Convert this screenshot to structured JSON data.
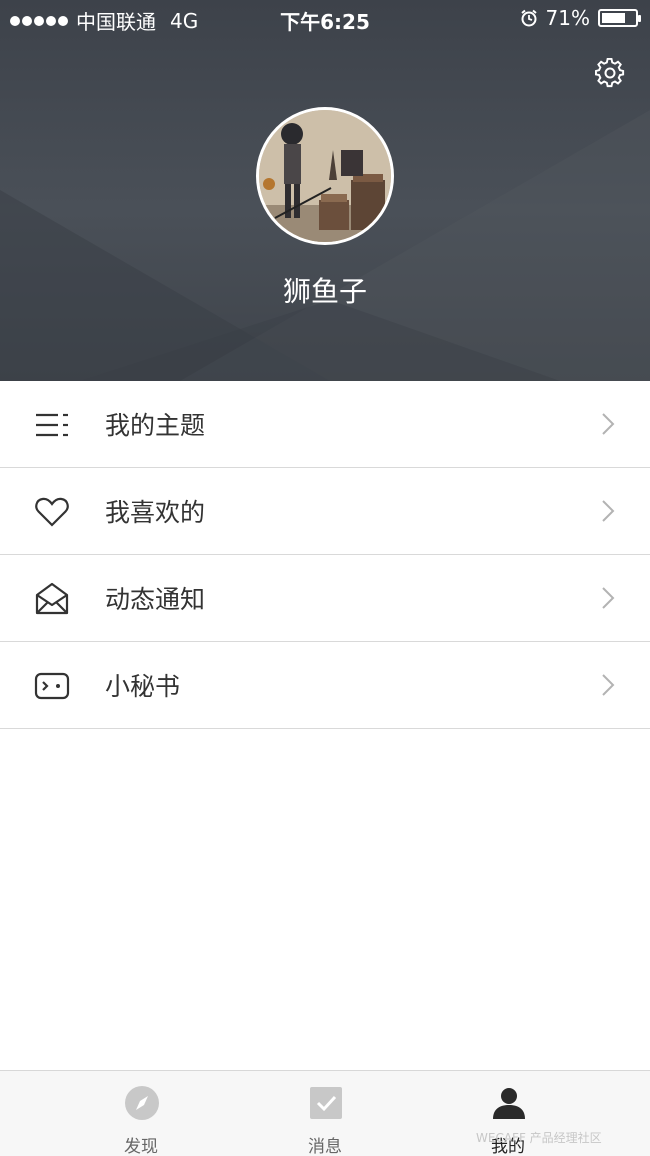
{
  "status_bar": {
    "carrier": "中国联通",
    "network": "4G",
    "time": "下午6:25",
    "battery_percent": "71%",
    "battery_level": 0.71
  },
  "profile": {
    "username": "狮鱼子",
    "settings_icon": "gear-icon",
    "avatar": "user-avatar"
  },
  "menu": [
    {
      "label": "我的主题",
      "icon": "list-icon"
    },
    {
      "label": "我喜欢的",
      "icon": "heart-icon"
    },
    {
      "label": "动态通知",
      "icon": "envelope-open-icon"
    },
    {
      "label": "小秘书",
      "icon": "assistant-icon"
    }
  ],
  "tabs": [
    {
      "label": "发现",
      "icon": "compass-icon",
      "active": false
    },
    {
      "label": "消息",
      "icon": "checkbox-icon",
      "active": false
    },
    {
      "label": "我的",
      "icon": "user-icon",
      "active": true
    }
  ],
  "watermark": "WECAFF 产品经理社区",
  "colors": {
    "header_bg": "#454a52",
    "text_primary": "#333333",
    "divider": "#d9d9d9",
    "tab_active": "#222222",
    "tab_inactive_icon": "#c8c8c8"
  }
}
